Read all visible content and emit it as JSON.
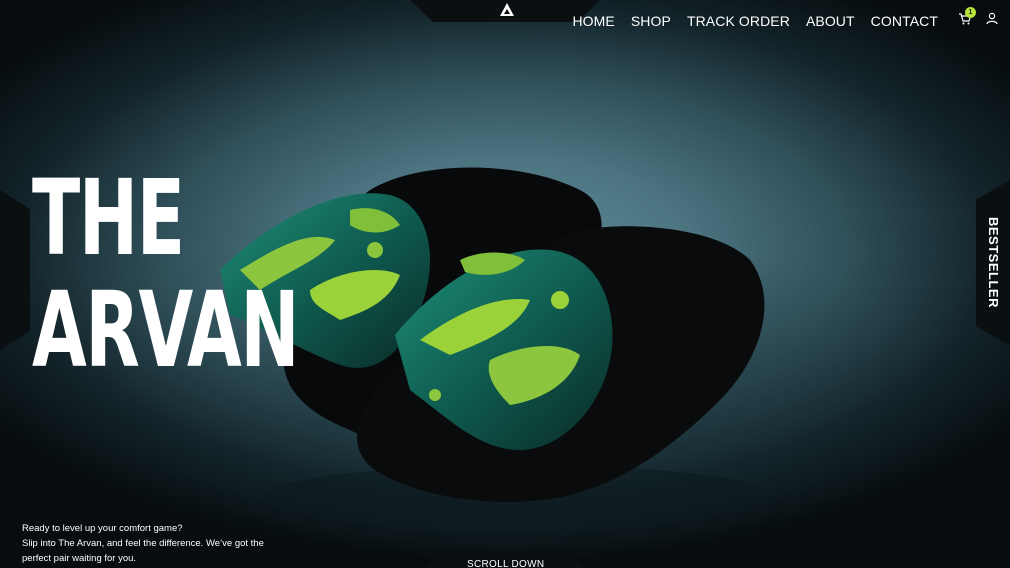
{
  "nav": {
    "items": [
      "HOME",
      "SHOP",
      "TRACK ORDER",
      "ABOUT",
      "CONTACT"
    ],
    "cart_count": "1"
  },
  "hero": {
    "title_line1": "THE",
    "title_line2": "ARVAN",
    "tagline_line1": "Ready to level up your comfort game?",
    "tagline_line2": "Slip into The Arvan, and feel the difference. We’ve got the",
    "tagline_line3": "perfect pair waiting for you.",
    "scroll_label": "SCROLL DOWN",
    "side_label": "BESTSELLER"
  },
  "icons": {
    "logo": "triangle-logo-icon",
    "cart": "cart-icon",
    "user": "user-icon"
  },
  "colors": {
    "accent": "#b6e23a",
    "background": "#4b7480",
    "text": "#ffffff"
  }
}
